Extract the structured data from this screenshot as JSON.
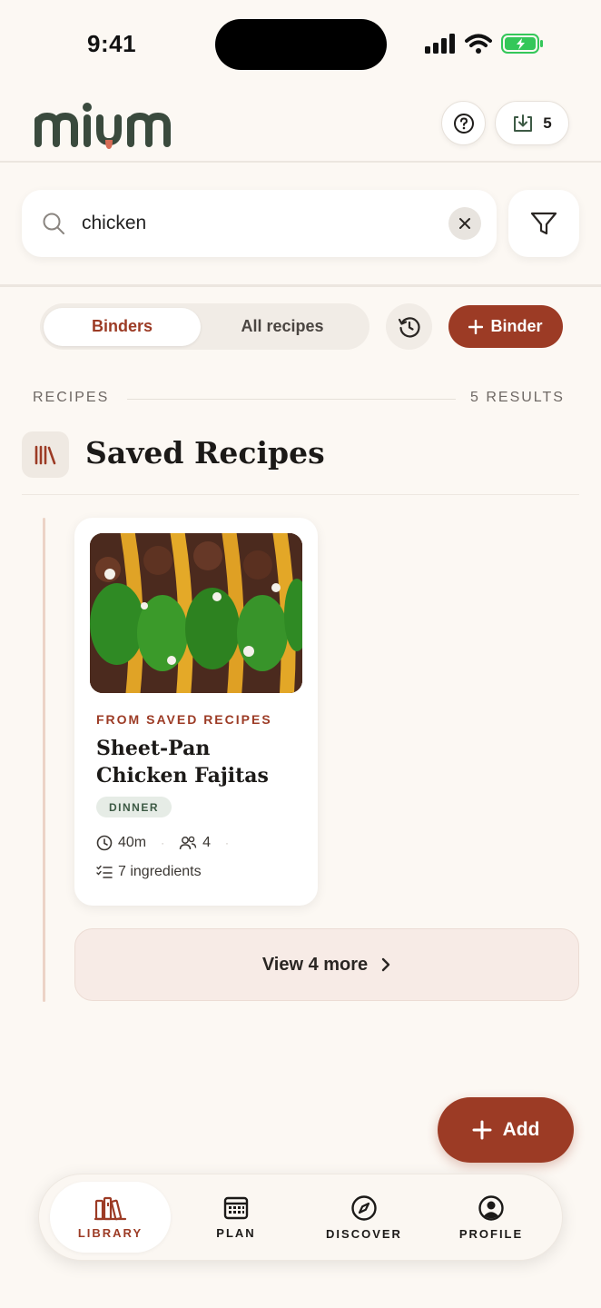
{
  "status_bar": {
    "time": "9:41"
  },
  "header": {
    "import_count": "5"
  },
  "search": {
    "value": "chicken"
  },
  "segment": {
    "active": "Binders",
    "inactive": "All recipes"
  },
  "add_binder_label": "Binder",
  "section": {
    "label": "RECIPES",
    "results": "5 RESULTS"
  },
  "binder": {
    "title": "Saved Recipes"
  },
  "recipe": {
    "source": "FROM SAVED RECIPES",
    "title": "Sheet-Pan Chicken Fajitas",
    "tag": "DINNER",
    "time": "40m",
    "servings": "4",
    "ingredients": "7 ingredients"
  },
  "view_more": "View 4 more",
  "fab_label": "Add",
  "nav": {
    "items": [
      {
        "label": "LIBRARY",
        "icon": "library-icon"
      },
      {
        "label": "PLAN",
        "icon": "calendar-icon"
      },
      {
        "label": "DISCOVER",
        "icon": "compass-icon"
      },
      {
        "label": "PROFILE",
        "icon": "profile-icon"
      }
    ]
  },
  "colors": {
    "accent": "#9c3b25",
    "background": "#fcf8f3",
    "logo_green": "#3a4a3d",
    "tag_green": "#3d5a45"
  }
}
